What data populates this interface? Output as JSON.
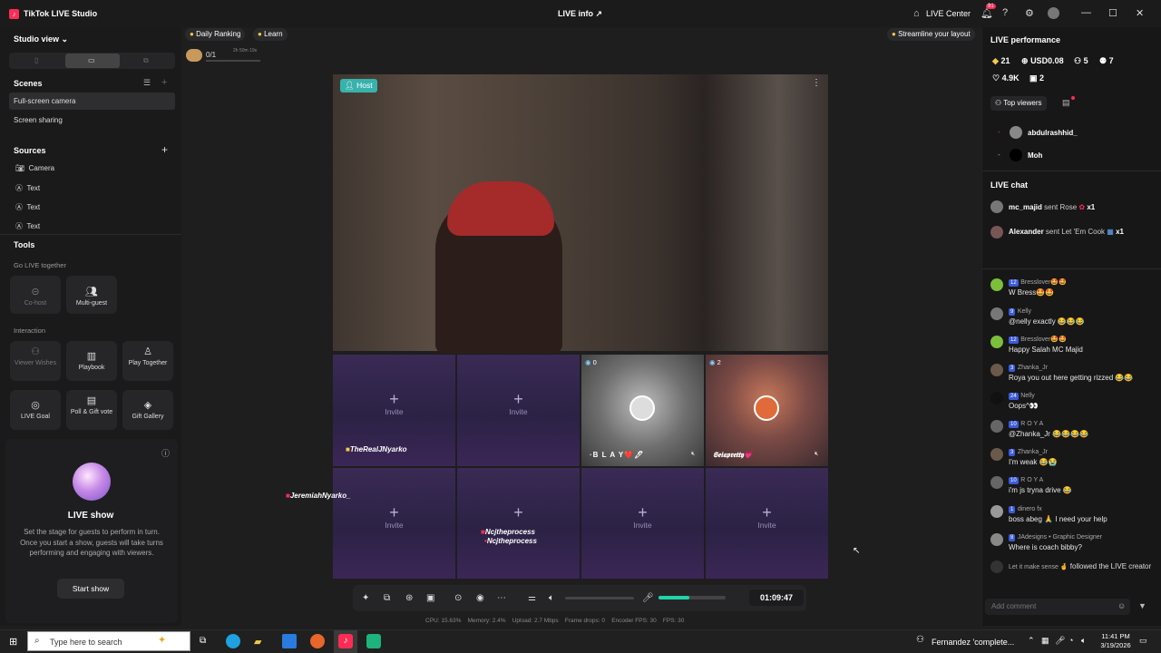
{
  "app": {
    "title": "TikTok LIVE Studio",
    "live_info": "LIVE info",
    "live_center": "LIVE Center",
    "notif_count": "91"
  },
  "left": {
    "studio_view": "Studio view",
    "scenes_title": "Scenes",
    "scenes": [
      "Full-screen camera",
      "Screen sharing"
    ],
    "sources_title": "Sources",
    "sources": [
      "Camera",
      "Text",
      "Text",
      "Text"
    ],
    "tools_title": "Tools",
    "go_live_together": "Go LIVE together",
    "cohost": "Co-host",
    "multiguest": "Multi-guest",
    "interaction": "Interaction",
    "viewer_wishes": "Viewer Wishes",
    "playbook": "Playbook",
    "play_together": "Play Together",
    "live_goal": "LIVE Goal",
    "poll": "Poll & Gift vote",
    "gift_gallery": "Gift Gallery",
    "live_show_title": "LIVE show",
    "live_show_desc": "Set the stage for guests to perform in turn. Once you start a show, guests will take turns performing and engaging with viewers.",
    "start_show": "Start show"
  },
  "stage": {
    "daily_ranking": "Daily Ranking",
    "learn": "Learn",
    "rank_value": "0/1",
    "rank_time": "2h 50m 19s",
    "streamline": "Streamline your layout",
    "host_label": "Host",
    "invite": "Invite",
    "guest1_name": "TheRealJNyarko",
    "guest2_name": "·B L A Y❤️🖊",
    "guest2_count": "0",
    "guest3_name": "𝕾𝖊𝖎𝖆𝖕𝖗𝖊𝖙𝖙𝖞💗",
    "guest3_count": "2",
    "side_name": "JeremiahNyarko_",
    "proc1": "Ncjtheprocess",
    "proc2": "Ncjtheprocess",
    "timer": "01:09:47",
    "status": "CPU: 15.63%    Memory: 2.4%    Upload: 2.7 Mbps    Frame drops: 0    Encoder FPS: 30    FPS: 30"
  },
  "right": {
    "perf_title": "LIVE performance",
    "diamonds": "21",
    "usd": "USD0.08",
    "viewers": "5",
    "new_followers": "7",
    "likes": "4.9K",
    "gifters": "2",
    "top_viewers": "Top viewers",
    "viewers_list": [
      {
        "name": "abdulrashhid_"
      },
      {
        "name": "Moh"
      }
    ],
    "chat_title": "LIVE chat",
    "gifts": [
      {
        "user": "mc_majid",
        "text": "sent Rose",
        "count": "x1"
      },
      {
        "user": "Alexander",
        "text": "sent Let 'Em Cook",
        "count": "x1"
      }
    ],
    "messages": [
      {
        "level": "12",
        "user": "Bresslover🤩🤩",
        "text": "W Bress🤩🤩"
      },
      {
        "level": "9",
        "user": "Kelly",
        "text": "@nelly exactly 😂😂😂"
      },
      {
        "level": "12",
        "user": "Bresslover🤩🤩",
        "text": "Happy Salah MC Majid"
      },
      {
        "level": "3",
        "user": "Zhanka_Jr",
        "text": "Roya you out here getting rizzed 😂😂"
      },
      {
        "level": "24",
        "user": "Nelly",
        "text": "Oops^👀"
      },
      {
        "level": "10",
        "user": "R O Y A",
        "text": "@Zhanka_Jr 😂😂😂😂"
      },
      {
        "level": "3",
        "user": "Zhanka_Jr",
        "text": "I'm weak 😂😭"
      },
      {
        "level": "10",
        "user": "R O Y A",
        "text": "i'm js tryna drive 😂"
      },
      {
        "level": "1",
        "user": "dinero fx",
        "text": "boss abeg 🙏 I need your help"
      },
      {
        "level": "8",
        "user": "JAdesigns • Graphic Designer",
        "text": "Where is coach bibby?"
      }
    ],
    "follow_user": "Let it make sense 🤞",
    "follow_text": "followed the LIVE creator",
    "comment_placeholder": "Add comment"
  },
  "taskbar": {
    "search": "Type here to search",
    "notif": "Fernandez 'complete...",
    "time": "11:41 PM",
    "date": "3/19/2026"
  }
}
